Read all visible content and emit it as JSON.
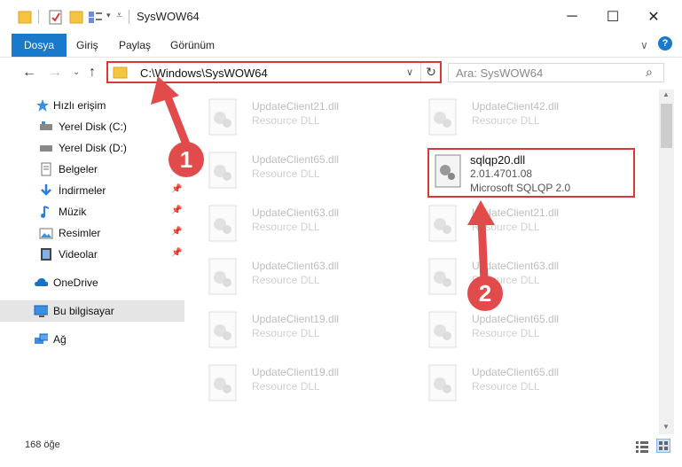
{
  "window": {
    "title": "SysWOW64",
    "minimize_glyph": "─",
    "maximize_glyph": "☐",
    "close_glyph": "✕"
  },
  "ribbon": {
    "tabs": [
      "Dosya",
      "Giriş",
      "Paylaş",
      "Görünüm"
    ],
    "expand_glyph": "∨",
    "help_glyph": "?"
  },
  "address_bar": {
    "path": "C:\\Windows\\SysWOW64",
    "search_placeholder": "Ara: SysWOW64"
  },
  "nav_pane": {
    "items": [
      {
        "label": "Hızlı erişim",
        "icon": "star-icon"
      },
      {
        "label": "Yerel Disk (C:)",
        "icon": "drive-icon"
      },
      {
        "label": "Yerel Disk (D:)",
        "icon": "drive-icon"
      },
      {
        "label": "Belgeler",
        "icon": "documents-icon",
        "pinned": true
      },
      {
        "label": "İndirmeler",
        "icon": "download-icon",
        "pinned": true
      },
      {
        "label": "Müzik",
        "icon": "music-icon",
        "pinned": true
      },
      {
        "label": "Resimler",
        "icon": "pictures-icon",
        "pinned": true
      },
      {
        "label": "Videolar",
        "icon": "video-icon",
        "pinned": true
      },
      {
        "label": "OneDrive",
        "icon": "cloud-icon"
      },
      {
        "label": "Bu bilgisayar",
        "icon": "computer-icon",
        "selected": true
      },
      {
        "label": "Ağ",
        "icon": "network-icon"
      }
    ]
  },
  "files": [
    {
      "name": "UpdateClient21.dll",
      "desc": "Resource DLL"
    },
    {
      "name": "UpdateClient42.dll",
      "desc": "Resource DLL"
    },
    {
      "name": "UpdateClient65.dll",
      "desc": "Resource DLL"
    },
    {
      "name": "sqlqp20.dll",
      "desc": "2.01.4701.08",
      "sub": "Microsoft SQLQP 2.0",
      "highlighted": true
    },
    {
      "name": "UpdateClient63.dll",
      "desc": "Resource DLL"
    },
    {
      "name": "UpdateClient21.dll",
      "desc": "Resource DLL"
    },
    {
      "name": "UpdateClient63.dll",
      "desc": "Resource DLL"
    },
    {
      "name": "UpdateClient63.dll",
      "desc": "Resource DLL"
    },
    {
      "name": "UpdateClient19.dll",
      "desc": "Resource DLL"
    },
    {
      "name": "UpdateClient65.dll",
      "desc": "Resource DLL"
    },
    {
      "name": "UpdateClient19.dll",
      "desc": "Resource DLL"
    },
    {
      "name": "UpdateClient65.dll",
      "desc": "Resource DLL"
    }
  ],
  "status": {
    "item_count": "168 öğe"
  },
  "annotations": {
    "step1": "1",
    "step2": "2"
  },
  "colors": {
    "accent": "#1979ca",
    "highlight_red": "#d9383a",
    "bubble_red": "#e14b4b"
  }
}
